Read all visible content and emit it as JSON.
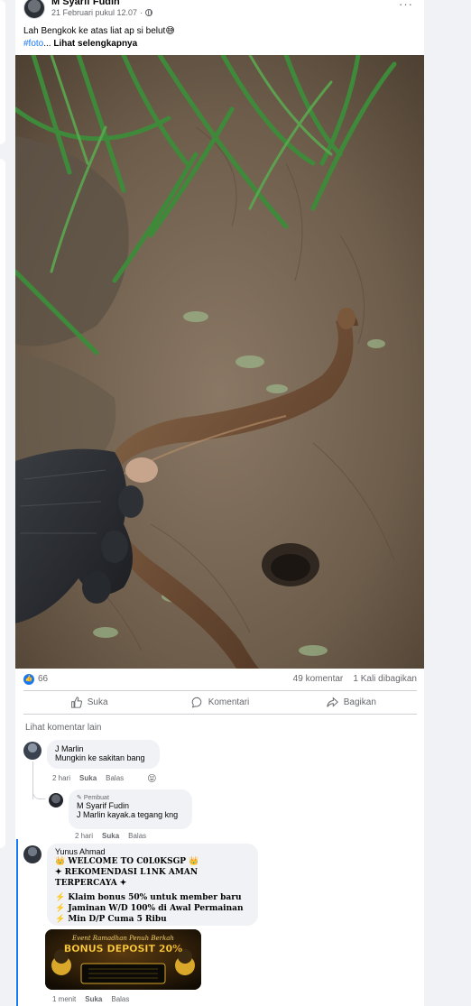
{
  "post": {
    "author": "M Syarif Fudin",
    "timestamp": "21 Februari pukul 12.07",
    "separator": "·",
    "caption": "Lah Bengkok ke atas liat ap si belut😅",
    "hashtag": "#foto",
    "ellipsis": "...",
    "see_more": "Lihat selengkapnya",
    "more_icon": "···"
  },
  "stats": {
    "likes": "66",
    "comments": "49 komentar",
    "shares": "1 Kali dibagikan"
  },
  "actions": {
    "like": "Suka",
    "comment": "Komentari",
    "share": "Bagikan"
  },
  "view_more_comments": "Lihat komentar lain",
  "comments": [
    {
      "name": "J Marlin",
      "text": "Mungkin ke sakitan bang",
      "time": "2 hari",
      "like": "Suka",
      "reply": "Balas"
    },
    {
      "badge": "Pembuat",
      "name": "M Syarif Fudin",
      "text_name": "J Marlin",
      "text": "kayak.a tegang kng",
      "time": "2 hari",
      "like": "Suka",
      "reply": "Balas"
    },
    {
      "name": "Yunus Ahmad",
      "line1": "👑 WELCOME TO C0L0KSGP 👑",
      "line2": "✦ REKOMENDASI L1NK AMAN TERPERCAYA ✦",
      "line3": "⚡ Klaim bonus 50% untuk member baru",
      "line4": "⚡ Jaminan W/D 100% di Awal Permainan",
      "line5": "⚡ Min D/P Cuma 5 Ribu",
      "banner_title": "BONUS DEPOSIT 20%",
      "banner_sub": "Event Ramadhan Penuh Berkah",
      "time": "1 menit",
      "like": "Suka",
      "reply": "Balas"
    }
  ],
  "colors": {
    "accent": "#1877f2",
    "secondary_text": "#65676b",
    "bubble": "#f0f2f5"
  }
}
